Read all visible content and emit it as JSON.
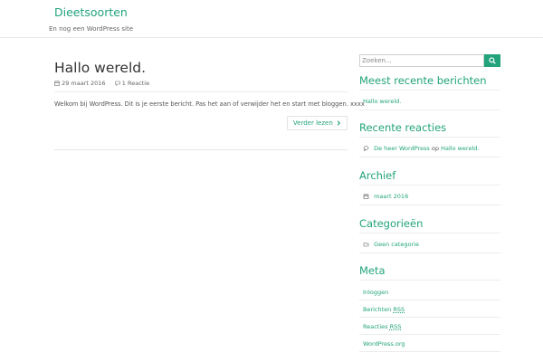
{
  "site": {
    "title": "Dieetsoorten",
    "description": "En nog een WordPress site"
  },
  "post": {
    "title": "Hallo wereld.",
    "date": "29 maart 2016",
    "comments": "1 Reactie",
    "excerpt": "Welkom bij WordPress. Dit is je eerste bericht. Pas het aan of verwijder het en start met bloggen. xxxx",
    "read_more": "Verder lezen"
  },
  "search": {
    "placeholder": "Zoeken..."
  },
  "widgets": {
    "recent_posts": {
      "title": "Meest recente berichten",
      "items": [
        "Hallo wereld."
      ]
    },
    "recent_comments": {
      "title": "Recente reacties",
      "author": "De heer WordPress",
      "connector": "op",
      "post": "Hallo wereld."
    },
    "archive": {
      "title": "Archief",
      "items": [
        "maart 2016"
      ]
    },
    "categories": {
      "title": "Categorieën",
      "items": [
        "Geen categorie"
      ]
    },
    "meta": {
      "title": "Meta",
      "login": "Inloggen",
      "posts_prefix": "Berichten",
      "posts_rss": "RSS",
      "comments_prefix": "Reacties",
      "comments_rss": "RSS",
      "wordpress": "WordPress.org"
    }
  },
  "colors": {
    "accent": "#22a37c",
    "text": "#555555",
    "divider": "#ececec"
  }
}
